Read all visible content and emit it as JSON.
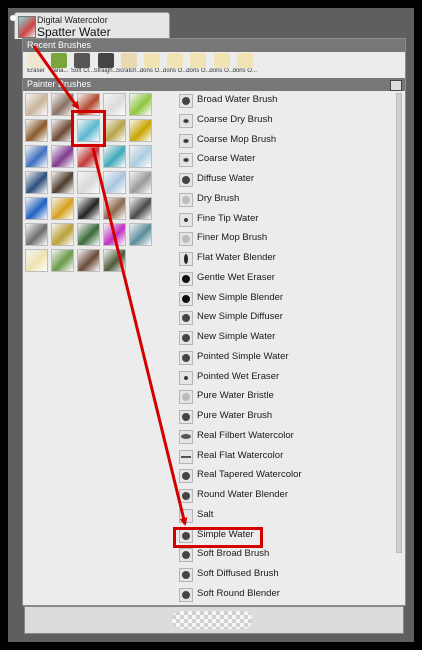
{
  "header": {
    "category": "Digital Watercolor",
    "variant": "Spatter Water"
  },
  "recent": {
    "title": "Recent Brushes",
    "items": [
      {
        "label": "Eraser",
        "color": "#f0e6cf"
      },
      {
        "label": "Varia...",
        "color": "#7aa43c"
      },
      {
        "label": "Soft Cl...",
        "color": "#555555"
      },
      {
        "label": "Straigh...",
        "color": "#444444"
      },
      {
        "label": "Scratch...",
        "color": "#e9d9b0"
      },
      {
        "label": "dons O...",
        "color": "#f2e3b5"
      },
      {
        "label": "dons O...",
        "color": "#f2e3b5"
      },
      {
        "label": "dons O...",
        "color": "#f2e3b5"
      },
      {
        "label": "dons O...",
        "color": "#f2e3b5"
      },
      {
        "label": "dons O...",
        "color": "#f2e3b5"
      }
    ]
  },
  "painter": {
    "title": "Painter Brushes"
  },
  "categories": [
    {
      "icon": "felt-brush-icon",
      "color": "#c9b49a"
    },
    {
      "icon": "blender-icon",
      "color": "#8a7060"
    },
    {
      "icon": "pen-icon",
      "color": "#b14a2e"
    },
    {
      "icon": "pencil-icon",
      "color": "#dcdcdc"
    },
    {
      "icon": "marker-icon",
      "color": "#8ec63f"
    },
    {
      "icon": "chalk-icon",
      "color": "#8a5a2b"
    },
    {
      "icon": "oil-icon",
      "color": "#6d4a34"
    },
    {
      "icon": "digital-watercolor-icon",
      "color": "#5ab7d0"
    },
    {
      "icon": "airbrush-icon",
      "color": "#b7a34a"
    },
    {
      "icon": "star-icon",
      "color": "#c9a400"
    },
    {
      "icon": "sponge-icon",
      "color": "#3f6fc0"
    },
    {
      "icon": "acrylic-icon",
      "color": "#7e3b8e"
    },
    {
      "icon": "calligraphy-icon",
      "color": "#c43a3a"
    },
    {
      "icon": "watercolor-icon",
      "color": "#3fa8b8"
    },
    {
      "icon": "liquid-ink-icon",
      "color": "#a9cde0"
    },
    {
      "icon": "gouache-icon",
      "color": "#2e4e7e"
    },
    {
      "icon": "charcoal-icon",
      "color": "#4d3b2b"
    },
    {
      "icon": "conte-icon",
      "color": "#d9d9d9"
    },
    {
      "icon": "crayon-icon",
      "color": "#a8c6e0"
    },
    {
      "icon": "pattern-pen-icon",
      "color": "#9a9a9a"
    },
    {
      "icon": "pastel-icon",
      "color": "#2060c0"
    },
    {
      "icon": "pencil-color-icon",
      "color": "#d8a020"
    },
    {
      "icon": "image-hose-icon",
      "color": "#222222"
    },
    {
      "icon": "palette-knife-icon",
      "color": "#8a6a50"
    },
    {
      "icon": "photo-icon",
      "color": "#4a4a4a"
    },
    {
      "icon": "art-pen-icon",
      "color": "#6e6e6e"
    },
    {
      "icon": "f-x-icon",
      "color": "#b9a13a"
    },
    {
      "icon": "impasto-icon",
      "color": "#3c6a3a"
    },
    {
      "icon": "particle-icon",
      "color": "#c030c0"
    },
    {
      "icon": "real-watercolor-icon",
      "color": "#5a8c9a"
    },
    {
      "icon": "custom-icon",
      "color": "#f0e3b0"
    },
    {
      "icon": "gradient-icon",
      "color": "#6a9a4a"
    },
    {
      "icon": "portrait-icon",
      "color": "#6b4a3a"
    },
    {
      "icon": "portrait-icon",
      "color": "#4d5a3a"
    }
  ],
  "variants": [
    {
      "label": "Broad Water Brush",
      "dot": "big"
    },
    {
      "label": "Coarse Dry Brush",
      "dot": "spray"
    },
    {
      "label": "Coarse Mop Brush",
      "dot": "spray"
    },
    {
      "label": "Coarse Water",
      "dot": "spray"
    },
    {
      "label": "Diffuse Water",
      "dot": "big"
    },
    {
      "label": "Dry Brush",
      "dot": "faint"
    },
    {
      "label": "Fine Tip Water",
      "dot": "tiny"
    },
    {
      "label": "Finer Mop Brush",
      "dot": "faint"
    },
    {
      "label": "Flat Water Blender",
      "dot": "oval"
    },
    {
      "label": "Gentle Wet Eraser",
      "dot": "solid"
    },
    {
      "label": "New Simple Blender",
      "dot": "solid"
    },
    {
      "label": "New Simple Diffuser",
      "dot": "big"
    },
    {
      "label": "New Simple Water",
      "dot": "big"
    },
    {
      "label": "Pointed Simple Water",
      "dot": "big"
    },
    {
      "label": "Pointed Wet Eraser",
      "dot": "tiny"
    },
    {
      "label": "Pure Water Bristle",
      "dot": "faint"
    },
    {
      "label": "Pure Water Brush",
      "dot": "big"
    },
    {
      "label": "Real Filbert Watercolor",
      "dot": "flat"
    },
    {
      "label": "Real Flat Watercolor",
      "dot": "line"
    },
    {
      "label": "Real Tapered Watercolor",
      "dot": "big"
    },
    {
      "label": "Round Water Blender",
      "dot": "big"
    },
    {
      "label": "Salt",
      "dot": "none"
    },
    {
      "label": "Simple Water",
      "dot": "big"
    },
    {
      "label": "Soft Broad Brush",
      "dot": "big"
    },
    {
      "label": "Soft Diffused Brush",
      "dot": "big"
    },
    {
      "label": "Soft Round Blender",
      "dot": "big"
    }
  ],
  "annotations": {
    "color": "#d40000"
  }
}
